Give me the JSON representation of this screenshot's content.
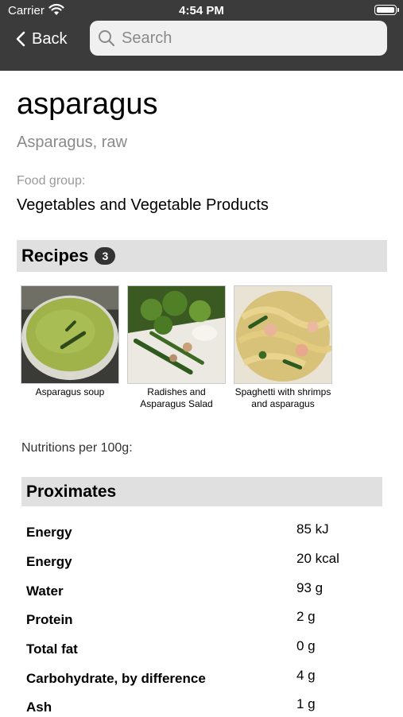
{
  "status_bar": {
    "carrier": "Carrier",
    "time": "4:54 PM"
  },
  "nav": {
    "back_label": "Back",
    "search_placeholder": "Search"
  },
  "food": {
    "name": "asparagus",
    "description": "Asparagus, raw",
    "food_group_label": "Food group:",
    "food_group": "Vegetables and Vegetable Products"
  },
  "recipes": {
    "label": "Recipes",
    "count": "3",
    "items": [
      {
        "caption": "Asparagus soup"
      },
      {
        "caption": "Radishes and Asparagus Salad"
      },
      {
        "caption": "Spaghetti with shrimps and asparagus"
      }
    ]
  },
  "nutrition": {
    "per_label": "Nutritions per 100g:",
    "section_title": "Proximates",
    "rows": [
      {
        "name": "Energy",
        "value": "85 kJ"
      },
      {
        "name": "Energy",
        "value": "20 kcal"
      },
      {
        "name": "Water",
        "value": "93 g"
      },
      {
        "name": "Protein",
        "value": "2 g"
      },
      {
        "name": "Total fat",
        "value": "0 g"
      },
      {
        "name": "Carbohydrate, by difference",
        "value": "4 g"
      },
      {
        "name": "Ash",
        "value": "1 g"
      }
    ]
  },
  "colors": {
    "header_bg": "#3b3b3b",
    "section_bg": "#e0e0e0",
    "badge_bg": "#333333"
  }
}
